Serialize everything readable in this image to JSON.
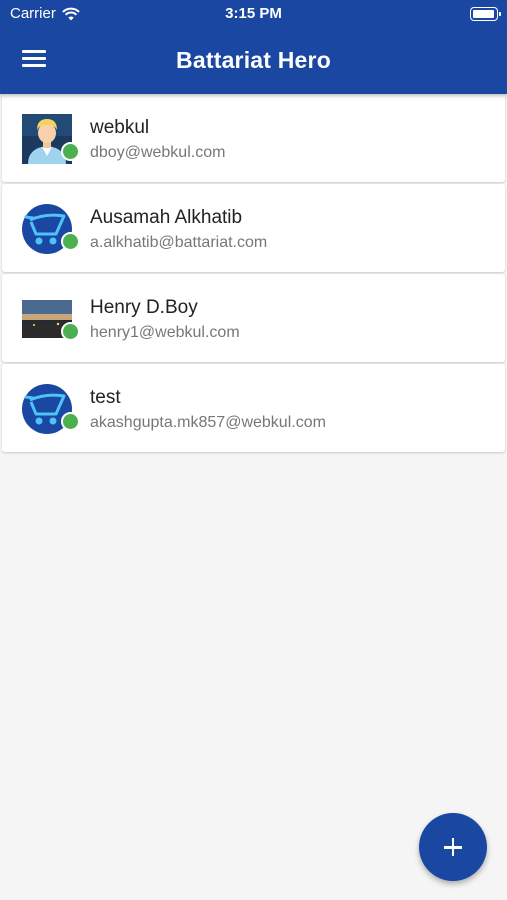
{
  "status_bar": {
    "carrier": "Carrier",
    "time": "3:15 PM",
    "battery_level": 1.0
  },
  "app_bar": {
    "title": "Battariat Hero",
    "menu_icon": "hamburger-menu-icon",
    "color": "#1a47a1"
  },
  "users": [
    {
      "name": "webkul",
      "email": "dboy@webkul.com",
      "avatar": "person-avatar",
      "status": "online"
    },
    {
      "name": "Ausamah Alkhatib",
      "email": "a.alkhatib@battariat.com",
      "avatar": "cart-logo-avatar",
      "status": "online"
    },
    {
      "name": "Henry D.Boy",
      "email": "henry1@webkul.com",
      "avatar": "landscape-photo-avatar",
      "status": "online"
    },
    {
      "name": "test",
      "email": "akashgupta.mk857@webkul.com",
      "avatar": "cart-logo-avatar",
      "status": "online"
    }
  ],
  "fab": {
    "icon": "plus-icon"
  },
  "colors": {
    "primary": "#1a47a1",
    "online": "#4caf50"
  }
}
